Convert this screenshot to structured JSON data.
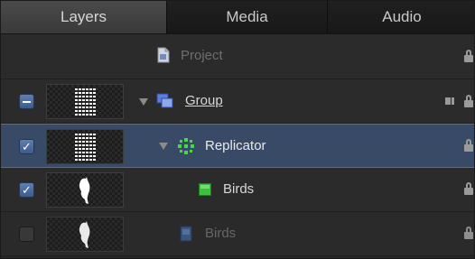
{
  "tabs": [
    {
      "label": "Layers"
    },
    {
      "label": "Media"
    },
    {
      "label": "Audio"
    }
  ],
  "rows": {
    "project": {
      "label": "Project"
    },
    "group": {
      "label": "Group"
    },
    "replicator": {
      "label": "Replicator"
    },
    "birds_shape": {
      "label": "Birds"
    },
    "birds_image": {
      "label": "Birds"
    }
  },
  "colors": {
    "selected_row": "#384a66",
    "checkbox": "#4a6a9e",
    "accent_green": "#3fbf3f"
  },
  "icons": {
    "project": "document-icon",
    "group": "group-layers-icon",
    "replicator": "replicator-icon",
    "shape": "green-square-icon",
    "image": "image-file-icon",
    "lock": "lock-icon"
  }
}
